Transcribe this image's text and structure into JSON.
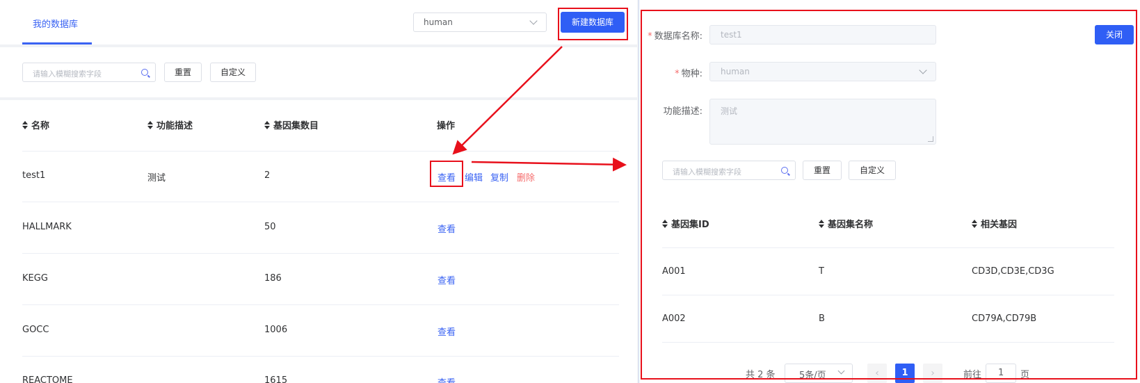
{
  "tabs": {
    "active": "我的数据库"
  },
  "species_select": {
    "value": "human"
  },
  "new_db_button": "新建数据库",
  "filter": {
    "search_placeholder": "请输入模糊搜索字段",
    "reset_label": "重置",
    "customize_label": "自定义"
  },
  "table": {
    "columns": [
      "名称",
      "功能描述",
      "基因集数目",
      "操作"
    ],
    "rows": [
      {
        "name": "test1",
        "desc": "测试",
        "count": "2",
        "actions": [
          "查看",
          "编辑",
          "复制",
          "删除"
        ]
      },
      {
        "name": "HALLMARK",
        "desc": "",
        "count": "50",
        "actions": [
          "查看"
        ]
      },
      {
        "name": "KEGG",
        "desc": "",
        "count": "186",
        "actions": [
          "查看"
        ]
      },
      {
        "name": "GOCC",
        "desc": "",
        "count": "1006",
        "actions": [
          "查看"
        ]
      },
      {
        "name": "REACTOME",
        "desc": "",
        "count": "1615",
        "actions": [
          "查看"
        ]
      }
    ]
  },
  "panel": {
    "close_label": "关闭",
    "fields": {
      "db_name_label": "数据库名称:",
      "db_name_value": "test1",
      "species_label": "物种:",
      "species_value": "human",
      "desc_label": "功能描述:",
      "desc_value": "测试"
    },
    "filter": {
      "search_placeholder": "请输入模糊搜索字段",
      "reset_label": "重置",
      "customize_label": "自定义"
    },
    "table": {
      "columns": [
        "基因集ID",
        "基因集名称",
        "相关基因"
      ],
      "rows": [
        {
          "id": "A001",
          "name": "T",
          "genes": "CD3D,CD3E,CD3G"
        },
        {
          "id": "A002",
          "name": "B",
          "genes": "CD79A,CD79B"
        }
      ]
    },
    "pagination": {
      "total": "共 2 条",
      "page_size": "5条/页",
      "prev": "‹",
      "current": "1",
      "next": "›",
      "goto_label": "前往",
      "goto_value": "1",
      "page_suffix": "页"
    }
  },
  "colors": {
    "accent": "#2f5ef5",
    "highlight": "#e8101b",
    "danger": "#f56c6c"
  }
}
